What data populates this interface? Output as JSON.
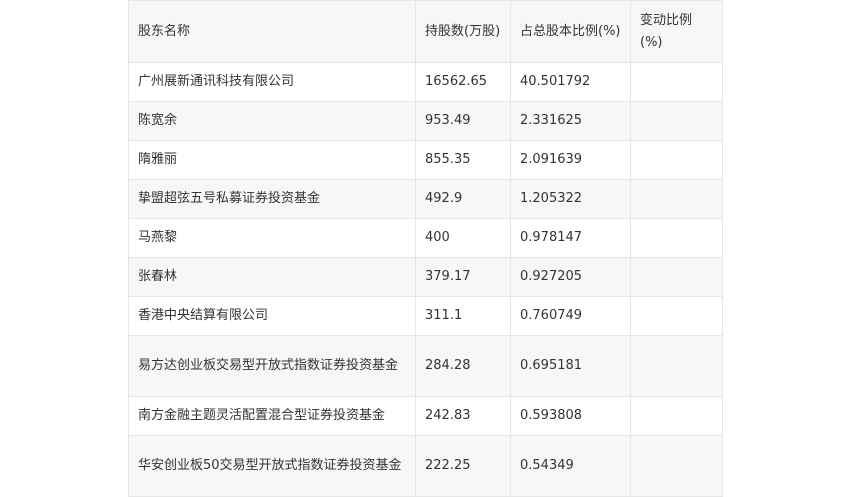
{
  "table": {
    "headers": [
      "股东名称",
      "持股数(万股)",
      "占总股本比例(%)",
      "变动比例(%)"
    ],
    "rows": [
      [
        "广州展新通讯科技有限公司",
        "16562.65",
        "40.501792",
        ""
      ],
      [
        "陈宽余",
        "953.49",
        "2.331625",
        ""
      ],
      [
        "隋雅丽",
        "855.35",
        "2.091639",
        ""
      ],
      [
        "挚盟超弦五号私募证券投资基金",
        "492.9",
        "1.205322",
        ""
      ],
      [
        "马燕黎",
        "400",
        "0.978147",
        ""
      ],
      [
        "张春林",
        "379.17",
        "0.927205",
        ""
      ],
      [
        "香港中央结算有限公司",
        "311.1",
        "0.760749",
        ""
      ],
      [
        "易方达创业板交易型开放式指数证券投资基金",
        "284.28",
        "0.695181",
        ""
      ],
      [
        "南方金融主题灵活配置混合型证券投资基金",
        "242.83",
        "0.593808",
        ""
      ],
      [
        "华安创业板50交易型开放式指数证券投资基金",
        "222.25",
        "0.54349",
        ""
      ]
    ]
  }
}
